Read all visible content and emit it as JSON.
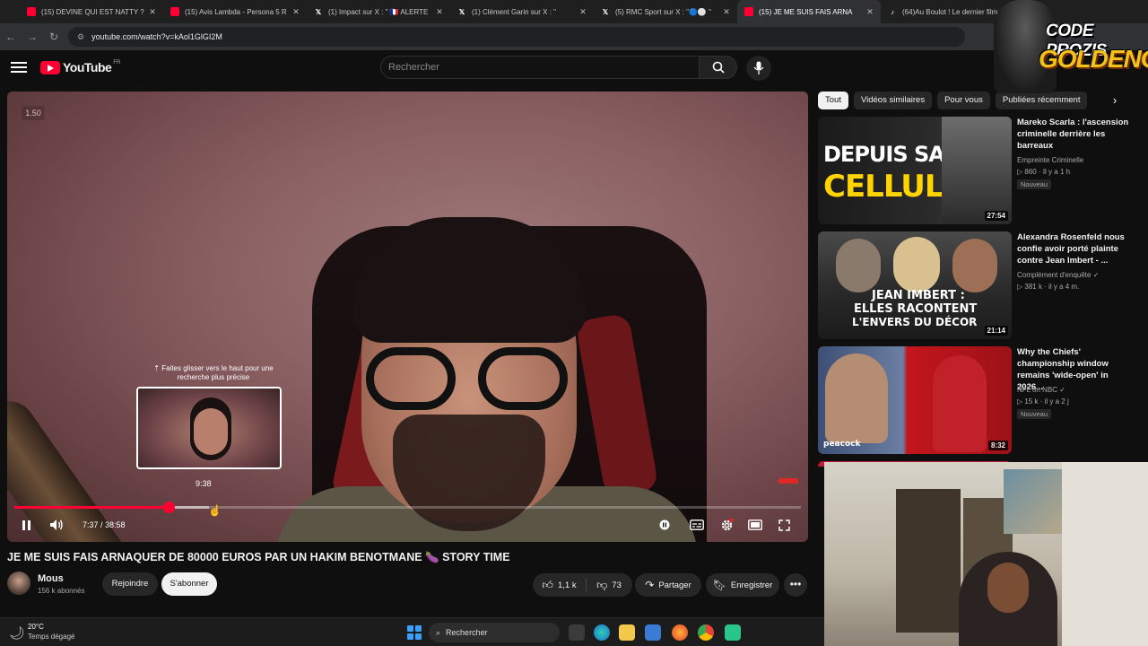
{
  "browser": {
    "tabs": [
      {
        "label": "(15) DEVINE QUI EST NATTY ?",
        "icon": "youtube-icon"
      },
      {
        "label": "(15) Avis Lambda - Persona 5 R",
        "icon": "youtube-icon"
      },
      {
        "label": "(1) Impact sur X : \" 🇫🇷 ALERTE",
        "icon": "x-icon"
      },
      {
        "label": "(1) Clément Garin sur X : \"",
        "icon": "x-icon"
      },
      {
        "label": "(5) RMC Sport sur X : \"🔵⚪ \"",
        "icon": "x-icon"
      },
      {
        "label": "(15) JE ME SUIS FAIS ARNA",
        "icon": "youtube-icon",
        "active": true
      },
      {
        "label": "(64)Au Boulot ! Le dernier film",
        "icon": "tiktok-icon"
      }
    ],
    "url": "youtube.com/watch?v=kAol1GlGI2M"
  },
  "header": {
    "logo_text": "YouTube",
    "logo_region": "FR",
    "search_placeholder": "Rechercher"
  },
  "player": {
    "speed_label": "1.50",
    "seek_hint": "⇡ Faites glisser vers le haut pour une recherche plus précise",
    "preview_time": "9:38",
    "time_display": "7:37 / 38:58",
    "progress_played": 0.196,
    "progress_hover": 0.247
  },
  "video": {
    "title": "JE ME SUIS FAIS ARNAQUER DE 80000 EUROS PAR UN HAKIM BENOTMANE 🍆 STORY TIME",
    "channel_name": "Mous",
    "channel_subs": "156 k abonnés",
    "join_label": "Rejoindre",
    "subscribe_label": "S'abonner",
    "likes": "1,1 k",
    "dislikes": "73",
    "share_label": "Partager",
    "save_label": "Enregistrer"
  },
  "chips": [
    "Tout",
    "Vidéos similaires",
    "Pour vous",
    "Publiées récemment"
  ],
  "recommendations": [
    {
      "title": "Mareko Scarla : l'ascension criminelle derrière les barreaux",
      "channel": "Empreinte Criminelle",
      "meta": "▷ 860 · Il y a 1 h",
      "badge": "Nouveau",
      "duration": "27:54",
      "thumb_text": [
        "DEPUIS SA",
        "CELLULE"
      ]
    },
    {
      "title": "Alexandra Rosenfeld nous confie avoir porté plainte contre Jean Imbert - ...",
      "channel": "Complément d'enquête ✓",
      "meta": "▷ 381 k · il y a 4 m.",
      "badge": "",
      "duration": "21:14",
      "thumb_text": [
        "JEAN IMBERT :",
        "ELLES RACONTENT",
        "L'ENVERS DU DÉCOR"
      ]
    },
    {
      "title": "Why the Chiefs' championship window remains 'wide-open' in 2026...",
      "channel": "NFL on NBC ✓",
      "meta": "▷ 15 k · il y a 2 j",
      "badge": "Nouveau",
      "duration": "8:32",
      "thumb_text": [
        "peacock"
      ]
    }
  ],
  "overlay": {
    "code_text": "CODE PROZIS",
    "brand_text": "GOLDENG"
  },
  "taskbar": {
    "temperature": "20°C",
    "weather": "Temps dégagé",
    "search_label": "Rechercher"
  },
  "colors": {
    "accent": "#ff0033",
    "background": "#0f0f0f",
    "overlay_gold": "#f2c21b"
  }
}
